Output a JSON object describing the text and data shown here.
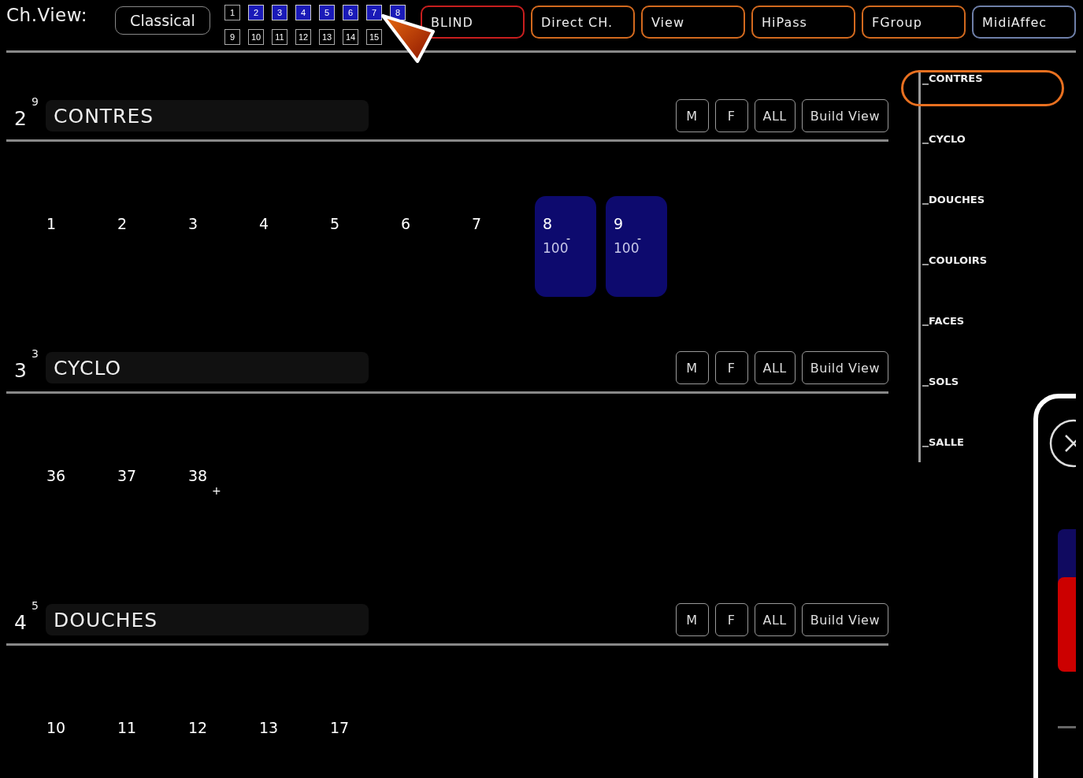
{
  "header": {
    "label": "Ch.View:",
    "mode": "Classical"
  },
  "pages": [
    {
      "label": "1",
      "selected": false
    },
    {
      "label": "2",
      "selected": true
    },
    {
      "label": "3",
      "selected": true
    },
    {
      "label": "4",
      "selected": true
    },
    {
      "label": "5",
      "selected": true
    },
    {
      "label": "6",
      "selected": true
    },
    {
      "label": "7",
      "selected": true
    },
    {
      "label": "8",
      "selected": true
    },
    {
      "label": "9",
      "selected": false
    },
    {
      "label": "10",
      "selected": false
    },
    {
      "label": "11",
      "selected": false
    },
    {
      "label": "12",
      "selected": false
    },
    {
      "label": "13",
      "selected": false
    },
    {
      "label": "14",
      "selected": false
    },
    {
      "label": "15",
      "selected": false
    }
  ],
  "functions": [
    {
      "label": "BLIND",
      "color": "#c81e1e"
    },
    {
      "label": "Direct CH.",
      "color": "#d2691e"
    },
    {
      "label": "View",
      "color": "#d2691e"
    },
    {
      "label": "HiPass",
      "color": "#d2691e"
    },
    {
      "label": "FGroup",
      "color": "#d2691e"
    },
    {
      "label": "MidiAffec",
      "color": "#6e7fa8"
    }
  ],
  "groups": [
    {
      "number": "2",
      "count": "9",
      "name": "CONTRES",
      "buttons": [
        "M",
        "F",
        "ALL",
        "Build View"
      ],
      "channels": [
        {
          "number": "1",
          "selected": false
        },
        {
          "number": "2",
          "selected": false
        },
        {
          "number": "3",
          "selected": false
        },
        {
          "number": "4",
          "selected": false
        },
        {
          "number": "5",
          "selected": false
        },
        {
          "number": "6",
          "selected": false
        },
        {
          "number": "7",
          "selected": false
        },
        {
          "number": "8",
          "selected": true,
          "mark": "-",
          "value": "100"
        },
        {
          "number": "9",
          "selected": true,
          "mark": "-",
          "value": "100"
        }
      ]
    },
    {
      "number": "3",
      "count": "3",
      "name": "CYCLO",
      "buttons": [
        "M",
        "F",
        "ALL",
        "Build View"
      ],
      "channels": [
        {
          "number": "36",
          "selected": false
        },
        {
          "number": "37",
          "selected": false
        },
        {
          "number": "38",
          "selected": false,
          "mark": "+"
        }
      ]
    },
    {
      "number": "4",
      "count": "5",
      "name": "DOUCHES",
      "buttons": [
        "M",
        "F",
        "ALL",
        "Build View"
      ],
      "channels": [
        {
          "number": "10",
          "selected": false
        },
        {
          "number": "11",
          "selected": false
        },
        {
          "number": "12",
          "selected": false
        },
        {
          "number": "13",
          "selected": false
        },
        {
          "number": "17",
          "selected": false
        }
      ]
    }
  ],
  "tree": [
    {
      "label": "CONTRES",
      "selected": true
    },
    {
      "label": "CYCLO",
      "selected": false
    },
    {
      "label": "DOUCHES",
      "selected": false
    },
    {
      "label": "COULOIRS",
      "selected": false
    },
    {
      "label": "FACES",
      "selected": false
    },
    {
      "label": "SOLS",
      "selected": false
    },
    {
      "label": "SALLE",
      "selected": false
    }
  ]
}
